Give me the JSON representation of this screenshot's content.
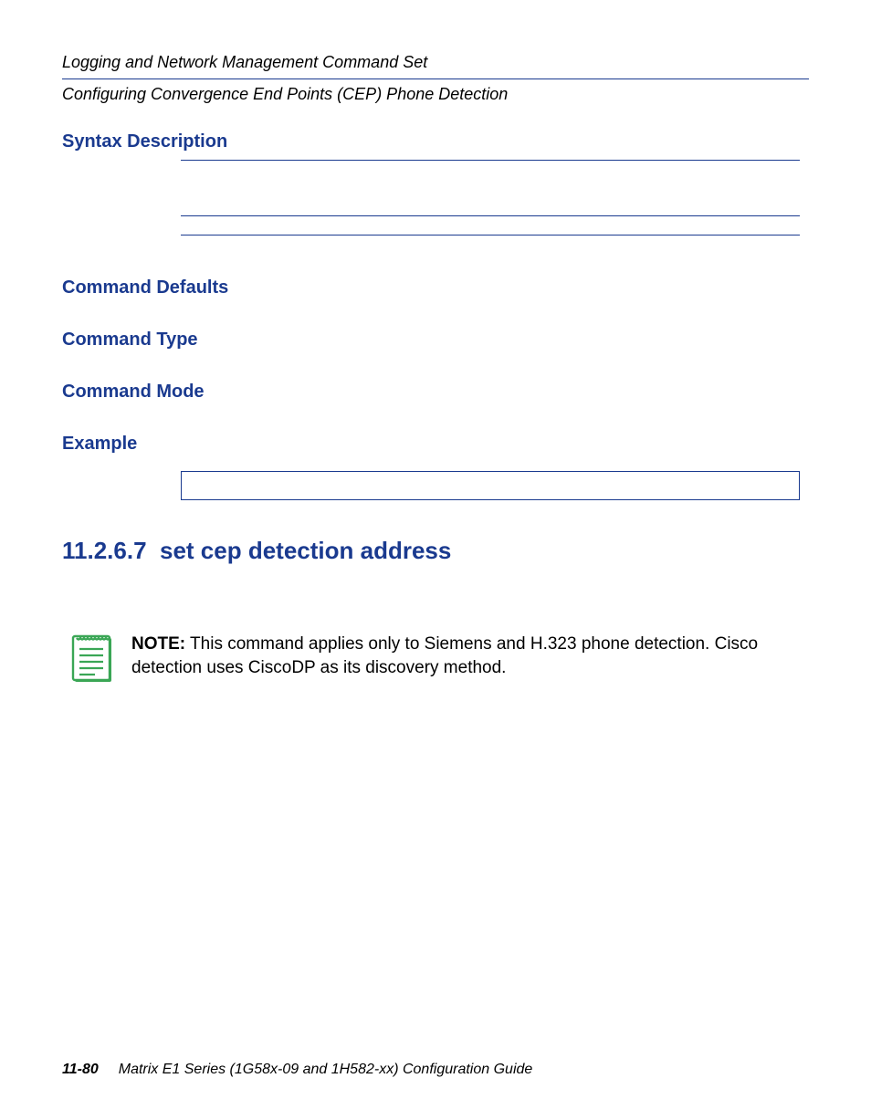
{
  "running_header": {
    "line1": "Logging and Network Management Command Set",
    "line2": "Configuring Convergence End Points (CEP) Phone Detection"
  },
  "sections": {
    "syntax_desc": "Syntax Description",
    "cmd_defaults": "Command Defaults",
    "cmd_type": "Command Type",
    "cmd_mode": "Command Mode",
    "example": "Example"
  },
  "subsection": {
    "number": "11.2.6.7",
    "title": "set cep detection address"
  },
  "note": {
    "label": "NOTE:",
    "body": "This command applies only to Siemens and H.323 phone detection. Cisco detection uses CiscoDP as its discovery method."
  },
  "footer": {
    "page_num": "11-80",
    "guide_title": "Matrix E1 Series (1G58x-09 and 1H582-xx) Configuration Guide"
  }
}
